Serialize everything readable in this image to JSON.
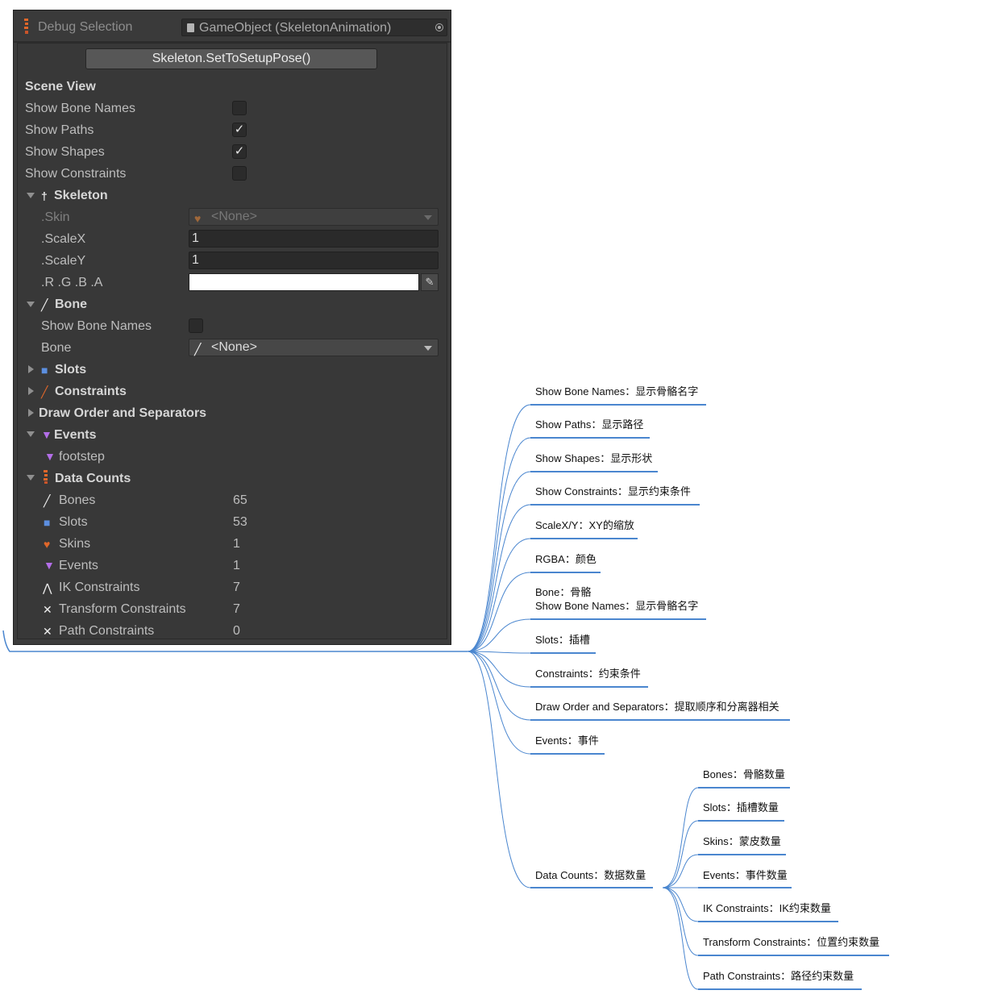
{
  "panel": {
    "title": "Debug Selection",
    "object_field": "GameObject (SkeletonAnimation)",
    "setup_pose_button": "Skeleton.SetToSetupPose()",
    "scene_view": {
      "header": "Scene View",
      "items": [
        {
          "label": "Show Bone Names",
          "checked": false,
          "check": ""
        },
        {
          "label": "Show Paths",
          "checked": true,
          "check": "✓"
        },
        {
          "label": "Show Shapes",
          "checked": true,
          "check": "✓"
        },
        {
          "label": "Show Constraints",
          "checked": false,
          "check": ""
        }
      ]
    },
    "skeleton": {
      "header": "Skeleton",
      "skin_label": ".Skin",
      "skin_value": "<None>",
      "scalex_label": ".ScaleX",
      "scalex_value": "1",
      "scaley_label": ".ScaleY",
      "scaley_value": "1",
      "rgba_label": ".R .G .B .A",
      "rgba_color": "#ffffff"
    },
    "bone": {
      "header": "Bone",
      "show_names_label": "Show Bone Names",
      "show_names_checked": false,
      "bone_label": "Bone",
      "bone_value": "<None>"
    },
    "slots_header": "Slots",
    "constraints_header": "Constraints",
    "draw_order_header": "Draw Order and Separators",
    "events": {
      "header": "Events",
      "items": [
        "footstep"
      ]
    },
    "data_counts": {
      "header": "Data Counts",
      "items": [
        {
          "label": "Bones",
          "value": "65"
        },
        {
          "label": "Slots",
          "value": "53"
        },
        {
          "label": "Skins",
          "value": "1"
        },
        {
          "label": "Events",
          "value": "1"
        },
        {
          "label": "IK Constraints",
          "value": "7"
        },
        {
          "label": "Transform Constraints",
          "value": "7"
        },
        {
          "label": "Path Constraints",
          "value": "0"
        }
      ]
    },
    "colors": {
      "panel_bg": "#3c3c3c",
      "text": "#bdbdbd",
      "accent_orange": "#e0672a",
      "accent_purple": "#b36ee8",
      "accent_blue": "#5c8fe0"
    }
  },
  "mindmap": {
    "line_color": "#4a86cf",
    "branches": [
      {
        "label": "Show Bone Names：显示骨骼名字"
      },
      {
        "label": "Show Paths：显示路径"
      },
      {
        "label": "Show Shapes：显示形状"
      },
      {
        "label": "Show Constraints：显示约束条件"
      },
      {
        "label": "ScaleX/Y：XY的缩放"
      },
      {
        "label": "RGBA：颜色"
      },
      {
        "label": "Bone：骨骼",
        "label2": "Show Bone Names：显示骨骼名字"
      },
      {
        "label": "Slots：插槽"
      },
      {
        "label": "Constraints：约束条件"
      },
      {
        "label": "Draw Order and Separators：提取顺序和分离器相关"
      },
      {
        "label": "Events：事件"
      },
      {
        "label": "Data Counts：数据数量"
      }
    ],
    "data_counts_children": [
      {
        "label": "Bones：骨骼数量"
      },
      {
        "label": "Slots：插槽数量"
      },
      {
        "label": "Skins：蒙皮数量"
      },
      {
        "label": "Events：事件数量"
      },
      {
        "label": "IK Constraints：IK约束数量"
      },
      {
        "label": "Transform Constraints：位置约束数量"
      },
      {
        "label": "Path Constraints：路径约束数量"
      }
    ]
  }
}
